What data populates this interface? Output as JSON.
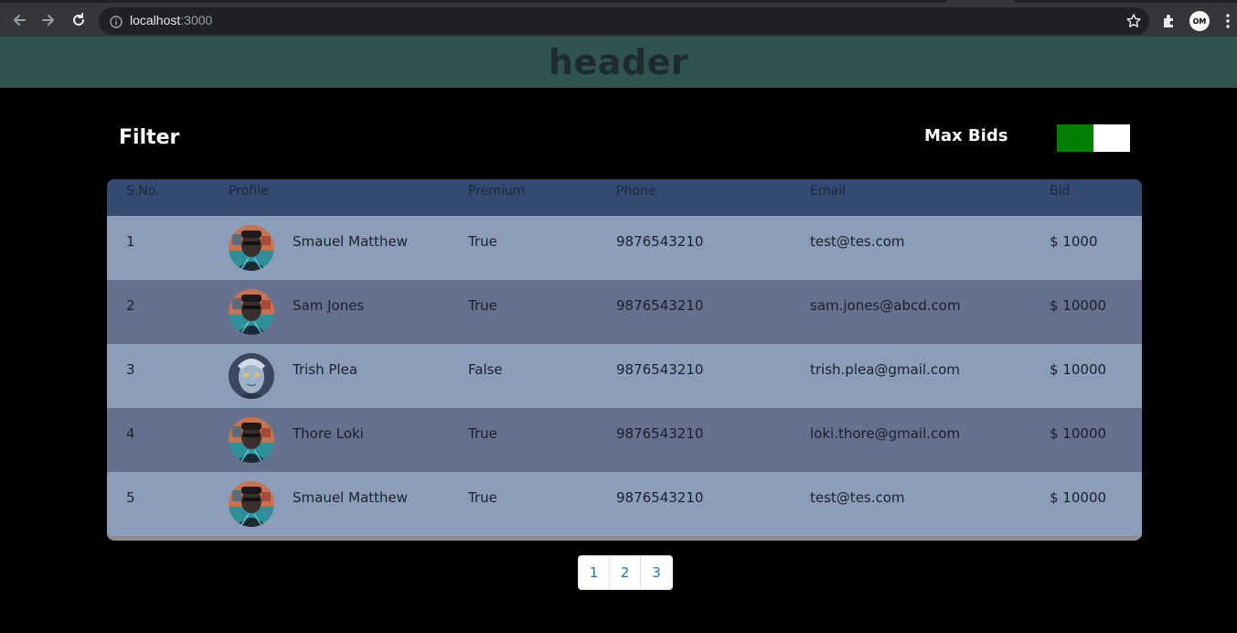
{
  "browser": {
    "url_host": "localhost",
    "url_port": ":3000",
    "profile_initials": "OM"
  },
  "app": {
    "header_title": "header"
  },
  "filter": {
    "title": "Filter",
    "max_bids_label": "Max Bids",
    "max_bids_enabled": true
  },
  "table": {
    "columns": [
      "S.No.",
      "Profile",
      "Premium",
      "Phone",
      "Email",
      "Bid"
    ],
    "rows": [
      {
        "sno": "1",
        "name": "Smauel Matthew",
        "premium": "True",
        "phone": "9876543210",
        "email": "test@tes.com",
        "bid": "$ 1000",
        "avatar": "masked-man"
      },
      {
        "sno": "2",
        "name": "Sam Jones",
        "premium": "True",
        "phone": "9876543210",
        "email": "sam.jones@abcd.com",
        "bid": "$ 10000",
        "avatar": "masked-man"
      },
      {
        "sno": "3",
        "name": "Trish Plea",
        "premium": "False",
        "phone": "9876543210",
        "email": "trish.plea@gmail.com",
        "bid": "$ 10000",
        "avatar": "blue-figure"
      },
      {
        "sno": "4",
        "name": "Thore Loki",
        "premium": "True",
        "phone": "9876543210",
        "email": "loki.thore@gmail.com",
        "bid": "$ 10000",
        "avatar": "masked-man"
      },
      {
        "sno": "5",
        "name": "Smauel Matthew",
        "premium": "True",
        "phone": "9876543210",
        "email": "test@tes.com",
        "bid": "$ 10000",
        "avatar": "masked-man"
      }
    ]
  },
  "pagination": {
    "pages": [
      "1",
      "2",
      "3"
    ]
  },
  "colors": {
    "header_bg": "#2f5450",
    "toggle_on": "#008000",
    "row_light": "#8c9db9",
    "row_dark": "#65718f",
    "thead_bg": "#344a72"
  }
}
